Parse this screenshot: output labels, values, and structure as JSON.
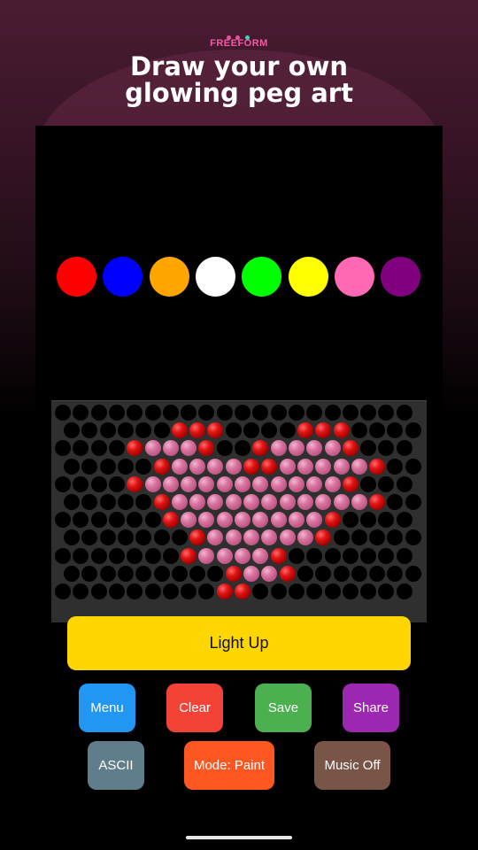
{
  "brand": {
    "name": "FREEFORM",
    "dot_colors": [
      "#e0559b",
      "#e0559b",
      "#3bd3c8"
    ]
  },
  "headline": {
    "line1": "Draw your own",
    "line2": "glowing peg art"
  },
  "palette": [
    {
      "name": "red",
      "color": "#ff0000"
    },
    {
      "name": "blue",
      "color": "#0000ff"
    },
    {
      "name": "orange",
      "color": "#ffa500"
    },
    {
      "name": "white",
      "color": "#ffffff"
    },
    {
      "name": "green",
      "color": "#00ff00"
    },
    {
      "name": "yellow",
      "color": "#ffff00"
    },
    {
      "name": "pink",
      "color": "#ff69b4"
    },
    {
      "name": "purple",
      "color": "#800080"
    }
  ],
  "pegboard": {
    "rows": 11,
    "cols": 20,
    "grid": [
      "....................",
      "......RRR....RRR....",
      "....RPPPR..RPPPPR...",
      ".....RPPPPRRPPPPPR..",
      "....RPPPPPPPPPPPR...",
      ".....RPPPPPPPPPPPR..",
      "......RPPPPPPPPR....",
      ".......RPPPPPPR.....",
      ".......RPPPPR.......",
      ".........RPPR.......",
      ".........RR........."
    ]
  },
  "buttons": {
    "light_up": "Light Up",
    "menu": "Menu",
    "clear": "Clear",
    "save": "Save",
    "share": "Share",
    "ascii": "ASCII",
    "mode": "Mode: Paint",
    "music": "Music Off"
  },
  "button_colors": {
    "light_up": "#ffd600",
    "menu": "#2196f3",
    "clear": "#f44336",
    "save": "#4caf50",
    "share": "#9c27b0",
    "ascii": "#607d8b",
    "mode": "#ff5722",
    "music": "#795548"
  }
}
